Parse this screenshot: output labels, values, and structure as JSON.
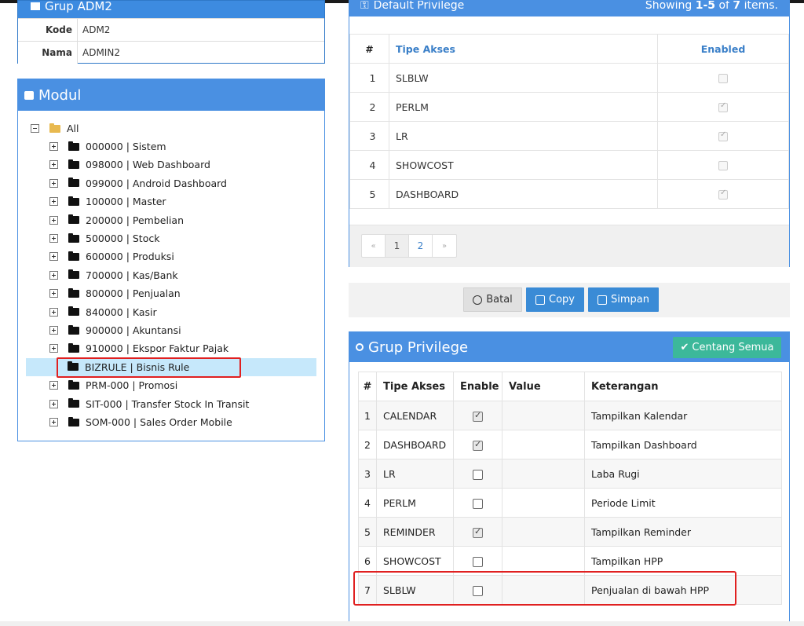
{
  "group_panel": {
    "title": "Grup ADM2",
    "kode_label": "Kode",
    "kode_value": "ADM2",
    "nama_label": "Nama",
    "nama_value": "ADMIN2"
  },
  "modul": {
    "title": "Modul",
    "root": "All",
    "items": [
      {
        "label": "000000 | Sistem"
      },
      {
        "label": "098000 | Web Dashboard"
      },
      {
        "label": "099000 | Android Dashboard"
      },
      {
        "label": "100000 | Master"
      },
      {
        "label": "200000 | Pembelian"
      },
      {
        "label": "500000 | Stock"
      },
      {
        "label": "600000 | Produksi"
      },
      {
        "label": "700000 | Kas/Bank"
      },
      {
        "label": "800000 | Penjualan"
      },
      {
        "label": "840000 | Kasir"
      },
      {
        "label": "900000 | Akuntansi"
      },
      {
        "label": "910000 | Ekspor Faktur Pajak"
      },
      {
        "label": "BIZRULE | Bisnis Rule",
        "selected": true
      },
      {
        "label": "PRM-000 | Promosi"
      },
      {
        "label": "SIT-000 | Transfer Stock In Transit"
      },
      {
        "label": "SOM-000 | Sales Order Mobile"
      }
    ]
  },
  "default_privilege": {
    "title": "Default Privilege",
    "summary_prefix": "Showing ",
    "summary_range": "1-5",
    "summary_mid": " of ",
    "summary_total": "7",
    "summary_suffix": " items.",
    "headers": {
      "num": "#",
      "tipe": "Tipe Akses",
      "enabled": "Enabled"
    },
    "rows": [
      {
        "num": "1",
        "tipe": "SLBLW",
        "enabled": false
      },
      {
        "num": "2",
        "tipe": "PERLM",
        "enabled": true
      },
      {
        "num": "3",
        "tipe": "LR",
        "enabled": true
      },
      {
        "num": "4",
        "tipe": "SHOWCOST",
        "enabled": false
      },
      {
        "num": "5",
        "tipe": "DASHBOARD",
        "enabled": true
      }
    ],
    "pager": {
      "prev": "«",
      "pages": [
        "1",
        "2"
      ],
      "next": "»",
      "current": "1"
    }
  },
  "actions": {
    "batal": "Batal",
    "copy": "Copy",
    "simpan": "Simpan"
  },
  "grup_privilege": {
    "title": "Grup Privilege",
    "centang_semua": "Centang Semua",
    "headers": {
      "num": "#",
      "tipe": "Tipe Akses",
      "enable": "Enable",
      "value": "Value",
      "keterangan": "Keterangan"
    },
    "rows": [
      {
        "num": "1",
        "tipe": "CALENDAR",
        "enable": true,
        "value": "",
        "keterangan": "Tampilkan Kalendar"
      },
      {
        "num": "2",
        "tipe": "DASHBOARD",
        "enable": true,
        "value": "",
        "keterangan": "Tampilkan Dashboard"
      },
      {
        "num": "3",
        "tipe": "LR",
        "enable": false,
        "value": "",
        "keterangan": "Laba Rugi"
      },
      {
        "num": "4",
        "tipe": "PERLM",
        "enable": false,
        "value": "",
        "keterangan": "Periode Limit"
      },
      {
        "num": "5",
        "tipe": "REMINDER",
        "enable": true,
        "value": "",
        "keterangan": "Tampilkan Reminder"
      },
      {
        "num": "6",
        "tipe": "SHOWCOST",
        "enable": false,
        "value": "",
        "keterangan": "Tampilkan HPP"
      },
      {
        "num": "7",
        "tipe": "SLBLW",
        "enable": false,
        "value": "",
        "keterangan": "Penjualan di bawah HPP"
      }
    ]
  },
  "colors": {
    "panel_blue": "#4a90e2",
    "button_blue": "#3a8bd6",
    "button_green": "#3cb89a",
    "highlight_red": "#e02020",
    "selection": "#c6e8fb"
  }
}
